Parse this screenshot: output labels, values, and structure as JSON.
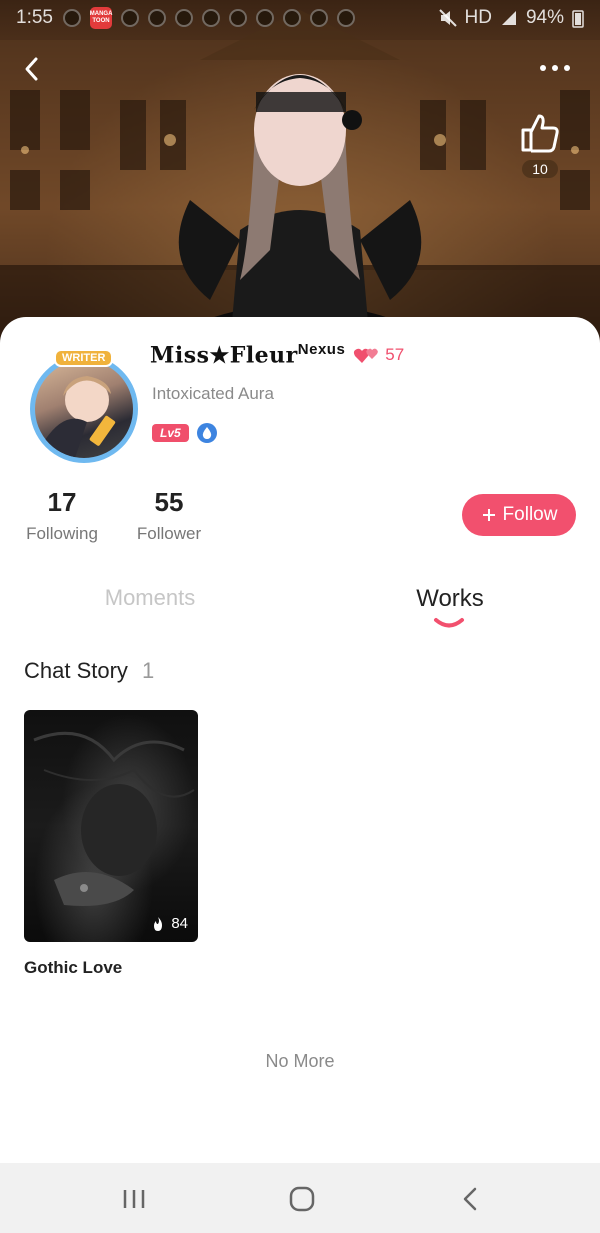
{
  "status_bar": {
    "time": "1:55",
    "app_badge_text": "MANGA TOON",
    "network": "HD",
    "battery": "94%"
  },
  "header": {
    "like_count": "10"
  },
  "profile": {
    "name": "Miss★Fleur",
    "name_suffix": "Nexus",
    "heart_count": "57",
    "subtitle": "Intoxicated Aura",
    "level_badge": "Lv5",
    "avatar_tag": "WRITER"
  },
  "stats": {
    "following_count": "17",
    "following_label": "Following",
    "follower_count": "55",
    "follower_label": "Follower"
  },
  "follow_button": {
    "label": "Follow"
  },
  "tabs": [
    {
      "label": "Moments",
      "active": false
    },
    {
      "label": "Works",
      "active": true
    }
  ],
  "works_section": {
    "title": "Chat Story",
    "count": "1",
    "items": [
      {
        "title": "Gothic Love",
        "views": "84"
      }
    ],
    "end_text": "No More"
  },
  "colors": {
    "accent": "#f2506e",
    "muted": "#8a8a8a"
  }
}
